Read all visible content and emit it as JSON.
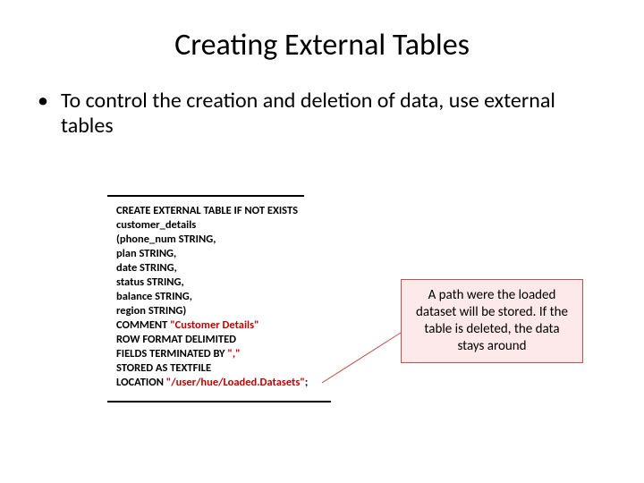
{
  "title": "Creating External Tables",
  "bullet": {
    "marker": "•",
    "text": "To control the creation and deletion of data, use external tables"
  },
  "code": {
    "l1a": "CREATE EXTERNAL TABLE IF NOT EXISTS",
    "l2": "customer_details",
    "l3": "(phone_num STRING,",
    "l4": "plan STRING,",
    "l5": "date STRING,",
    "l6": "status STRING,",
    "l7": "balance STRING,",
    "l8": "region STRING)",
    "l9a": "COMMENT ",
    "l9b": "\"Customer Details\"",
    "l10": "ROW FORMAT DELIMITED",
    "l11a": "FIELDS TERMINATED BY ",
    "l11b": "\",\"",
    "l12": "STORED AS TEXTFILE",
    "l13a": "LOCATION ",
    "l13b": "\"/user/hue/Loaded.Datasets\"",
    "l13c": ";"
  },
  "callout": "A path were the loaded dataset will be stored. If the table is deleted, the data stays around"
}
